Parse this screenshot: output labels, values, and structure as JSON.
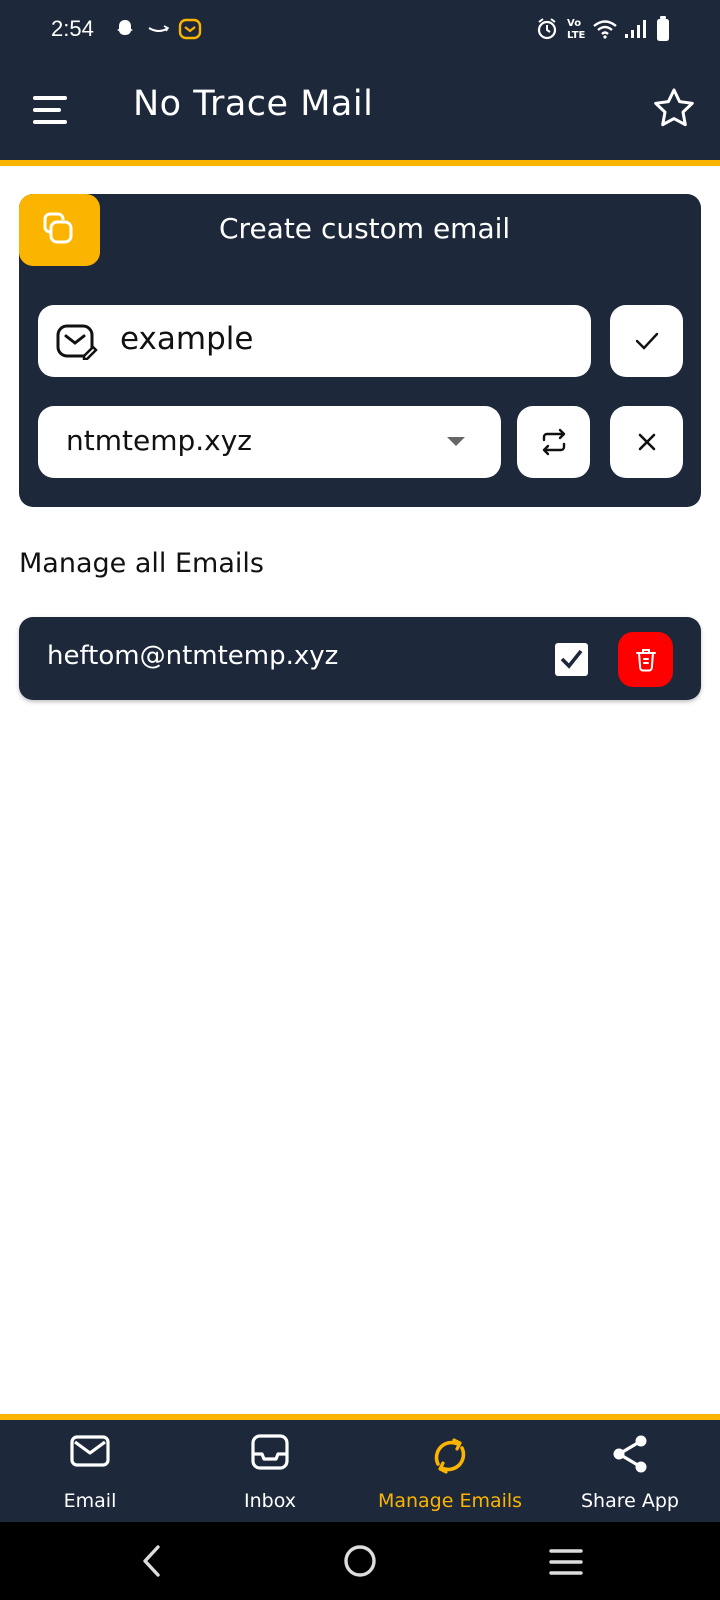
{
  "status_bar": {
    "time": "2:54",
    "icons": [
      "snapchat-icon",
      "amazon-icon",
      "mail-app-icon",
      "alarm-icon",
      "volte-icon",
      "wifi-icon",
      "signal-icon",
      "battery-icon"
    ],
    "network_label": "Vo LTE"
  },
  "app_bar": {
    "title": "No Trace Mail",
    "menu_icon": "menu-icon",
    "favorite_icon": "star-icon"
  },
  "create_card": {
    "title": "Create custom email",
    "name_input": {
      "value": "example",
      "icon": "mail-edit-icon"
    },
    "domain_select": {
      "selected": "ntmtemp.xyz"
    },
    "buttons": {
      "confirm_icon": "check-icon",
      "swap_icon": "swap-icon",
      "clear_icon": "close-icon"
    }
  },
  "manage": {
    "title": "Manage all Emails",
    "emails": [
      {
        "address": "heftom@ntmtemp.xyz",
        "selected": true
      }
    ]
  },
  "bottom_nav": {
    "items": [
      {
        "label": "Email",
        "icon": "mail-icon",
        "active": false
      },
      {
        "label": "Inbox",
        "icon": "inbox-icon",
        "active": false
      },
      {
        "label": "Manage Emails",
        "icon": "refresh-icon",
        "active": true
      },
      {
        "label": "Share App",
        "icon": "share-icon",
        "active": false
      }
    ]
  },
  "colors": {
    "primary": "#1d283a",
    "accent": "#fbb500",
    "danger": "#ff0000",
    "background": "#ffffff"
  }
}
